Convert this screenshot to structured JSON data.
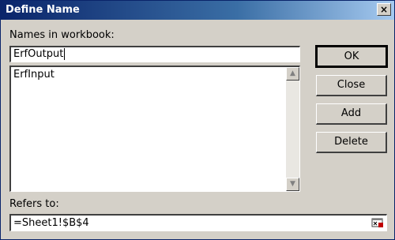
{
  "window": {
    "title": "Define Name",
    "close_glyph": "×"
  },
  "names_label": "Names in workbook:",
  "name_input_value": "ErfOutput",
  "list_items": [
    "ErfInput"
  ],
  "scroll_up_glyph": "▲",
  "scroll_down_glyph": "▼",
  "buttons": {
    "ok": "OK",
    "close": "Close",
    "add": "Add",
    "delete": "Delete"
  },
  "refers_label": "Refers to:",
  "refers_value": "=Sheet1!$B$4",
  "colors": {
    "titlebar_start": "#0a246a",
    "titlebar_end": "#a6caf0",
    "dialog_bg": "#d4d0c8"
  },
  "icons": {
    "collapse": "collapse-dialog-icon"
  }
}
